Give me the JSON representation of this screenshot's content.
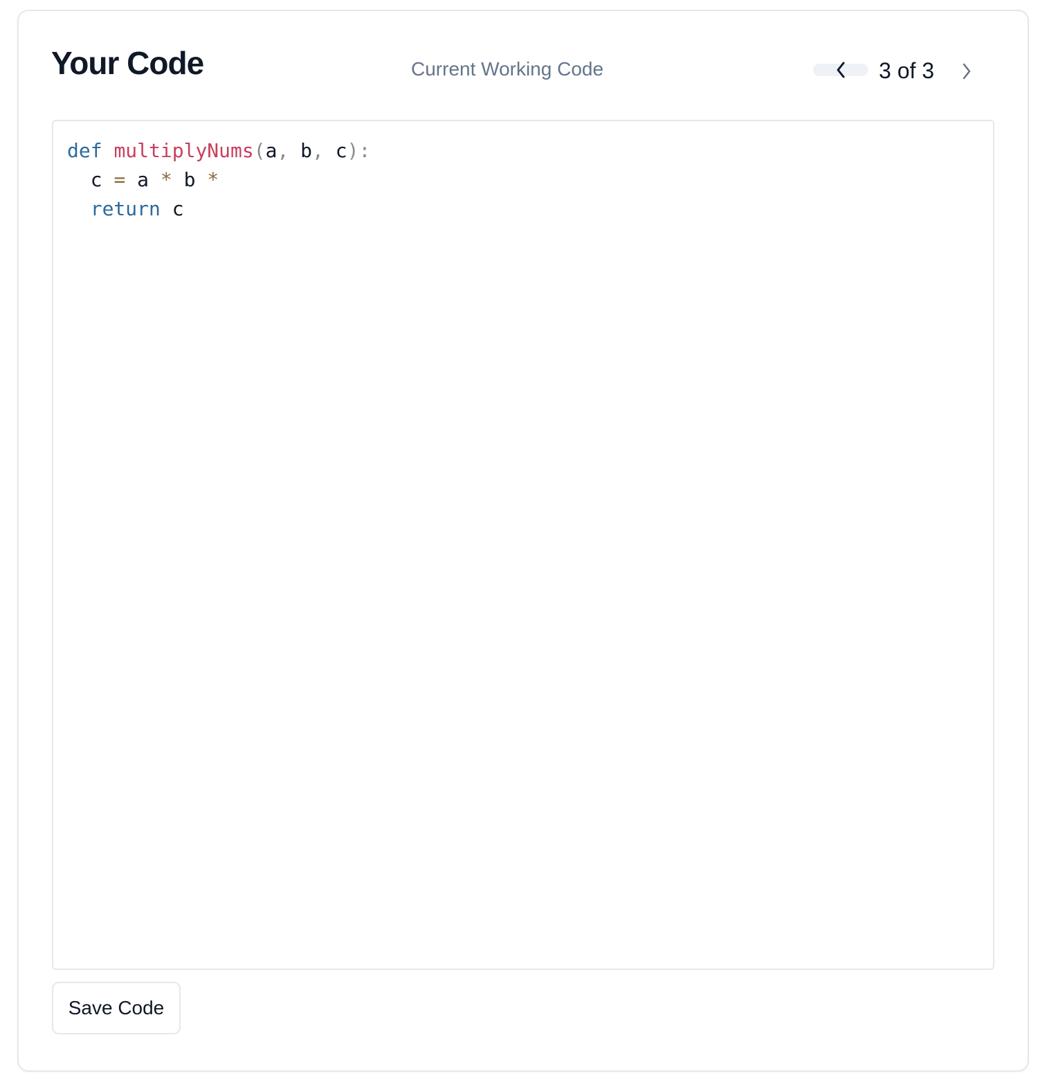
{
  "header": {
    "title": "Your Code",
    "subtitle": "Current Working Code",
    "pager": {
      "label": "3 of 3",
      "prev_icon": "chevron-left-icon",
      "next_icon": "chevron-right-icon"
    }
  },
  "editor": {
    "language": "python",
    "lines": [
      [
        {
          "t": "kw",
          "v": "def"
        },
        {
          "t": "id",
          "v": " "
        },
        {
          "t": "fn",
          "v": "multiplyNums"
        },
        {
          "t": "punc",
          "v": "("
        },
        {
          "t": "id",
          "v": "a"
        },
        {
          "t": "punc",
          "v": ", "
        },
        {
          "t": "id",
          "v": "b"
        },
        {
          "t": "punc",
          "v": ", "
        },
        {
          "t": "id",
          "v": "c"
        },
        {
          "t": "punc",
          "v": "):"
        }
      ],
      [
        {
          "t": "id",
          "v": "  c "
        },
        {
          "t": "op",
          "v": "="
        },
        {
          "t": "id",
          "v": " a "
        },
        {
          "t": "op",
          "v": "*"
        },
        {
          "t": "id",
          "v": " b "
        },
        {
          "t": "op",
          "v": "*"
        }
      ],
      [
        {
          "t": "id",
          "v": "  "
        },
        {
          "t": "kw",
          "v": "return"
        },
        {
          "t": "id",
          "v": " c"
        }
      ]
    ]
  },
  "footer": {
    "save_label": "Save Code"
  },
  "colors": {
    "keyword": "#2b6a9e",
    "function": "#c7405e",
    "operator": "#8b6a3e",
    "punctuation": "#8a8a8a",
    "subtitle": "#64748b",
    "border": "#e5e7eb"
  }
}
